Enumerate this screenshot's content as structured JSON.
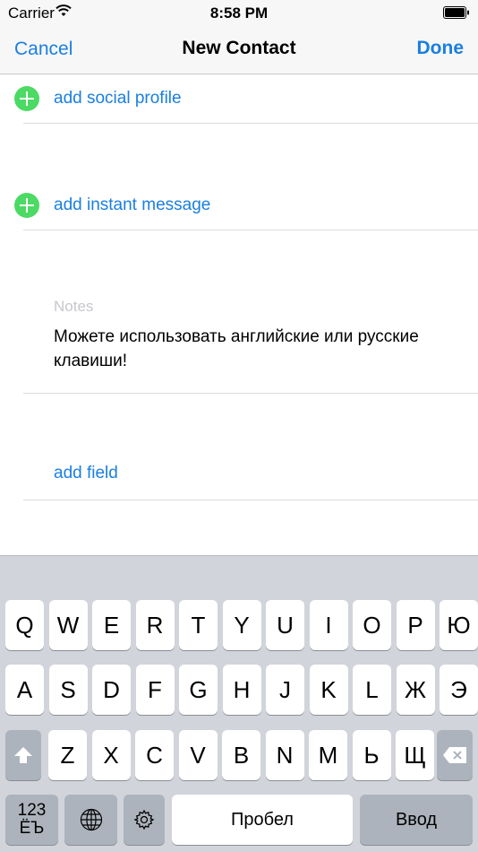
{
  "status_bar": {
    "carrier": "Carrier",
    "time": "8:58 PM"
  },
  "nav": {
    "cancel": "Cancel",
    "title": "New Contact",
    "done": "Done"
  },
  "rows": {
    "social": "add social profile",
    "instant": "add instant message",
    "add_field": "add field"
  },
  "notes": {
    "label": "Notes",
    "text": "Можете использовать английские или русские клавиши!"
  },
  "colors": {
    "accent": "#1a7fe0",
    "add_green": "#4cd964",
    "keyboard_bg": "#d1d4da",
    "fn_key": "#adb3bc"
  },
  "keyboard": {
    "row1": [
      "Q",
      "W",
      "E",
      "R",
      "T",
      "Y",
      "U",
      "I",
      "O",
      "P",
      "Ю"
    ],
    "row2": [
      "A",
      "S",
      "D",
      "F",
      "G",
      "H",
      "J",
      "K",
      "L",
      "Ж",
      "Э"
    ],
    "row3": [
      "Z",
      "X",
      "C",
      "V",
      "B",
      "N",
      "M",
      "Ь",
      "Щ"
    ],
    "numbers_key": "123\nЁЪ",
    "space": "Пробел",
    "return": "Ввод",
    "icons": {
      "shift": "shift-icon",
      "delete": "delete-icon",
      "globe": "globe-icon",
      "settings": "gear-icon"
    }
  }
}
